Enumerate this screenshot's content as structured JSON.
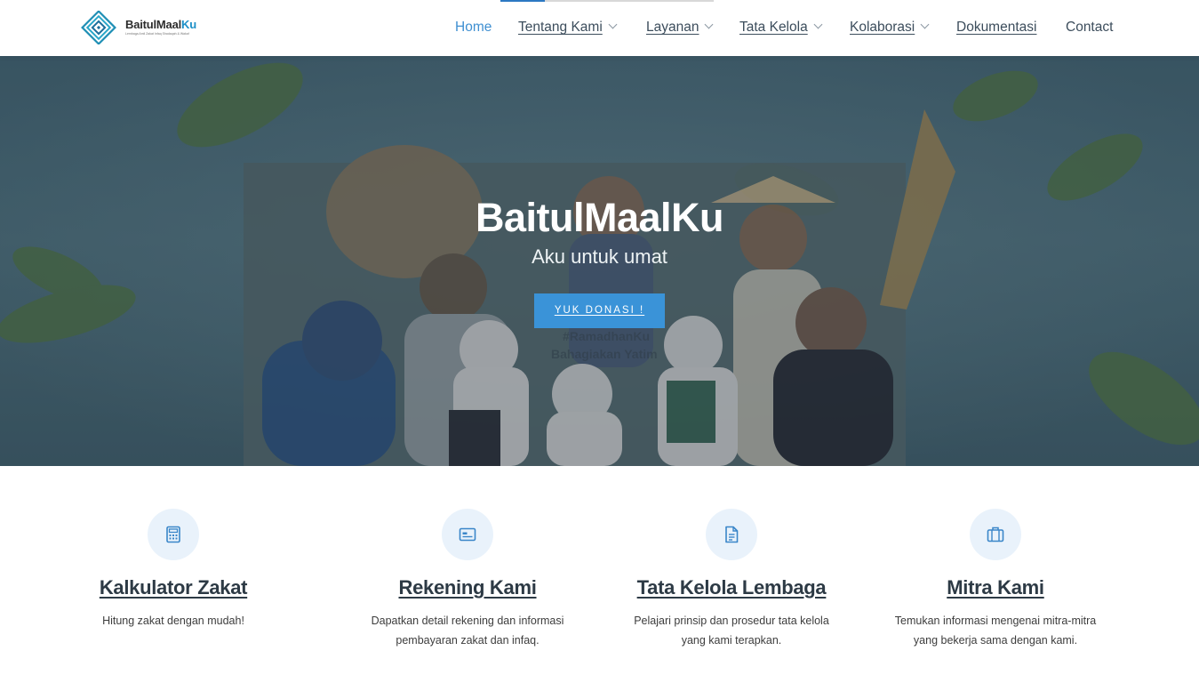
{
  "brand": {
    "name_main": "BaitulMaal",
    "name_accent": "Ku",
    "tagline": "Lembaga Amil Zakat Infaq Shadaqah & Wakaf"
  },
  "page_load_progress": 0.21,
  "nav": {
    "home": "Home",
    "tentang": "Tentang Kami",
    "layanan": "Layanan",
    "tata_kelola": "Tata Kelola",
    "kolaborasi": "Kolaborasi",
    "dokumentasi": "Dokumentasi",
    "contact": "Contact"
  },
  "hero": {
    "title": "BaitulMaalKu",
    "subtitle": "Aku untuk umat",
    "cta_label": "YUK DONASI !",
    "photo_text_1": "#RamadhanKu",
    "photo_text_2": "Bahagiakan Yatim"
  },
  "features": [
    {
      "icon": "calculator-icon",
      "title": "Kalkulator Zakat",
      "desc_line1": "Hitung zakat dengan mudah!",
      "desc_line2": ""
    },
    {
      "icon": "card-icon",
      "title": "Rekening Kami",
      "desc_line1": "Dapatkan detail rekening dan informasi",
      "desc_line2": "pembayaran zakat dan infaq."
    },
    {
      "icon": "document-icon",
      "title": "Tata Kelola Lembaga",
      "desc_line1": "Pelajari prinsip dan prosedur tata kelola",
      "desc_line2": "yang kami terapkan."
    },
    {
      "icon": "briefcase-icon",
      "title": "Mitra Kami",
      "desc_line1": "Temukan informasi mengenai mitra-mitra",
      "desc_line2": "yang bekerja sama dengan kami."
    }
  ],
  "colors": {
    "accent": "#3a93d8",
    "nav_active": "#3f8fd1",
    "nav_text": "#3c4d5c",
    "icon_bg": "#e9f2fb",
    "heading": "#2d3a45"
  }
}
